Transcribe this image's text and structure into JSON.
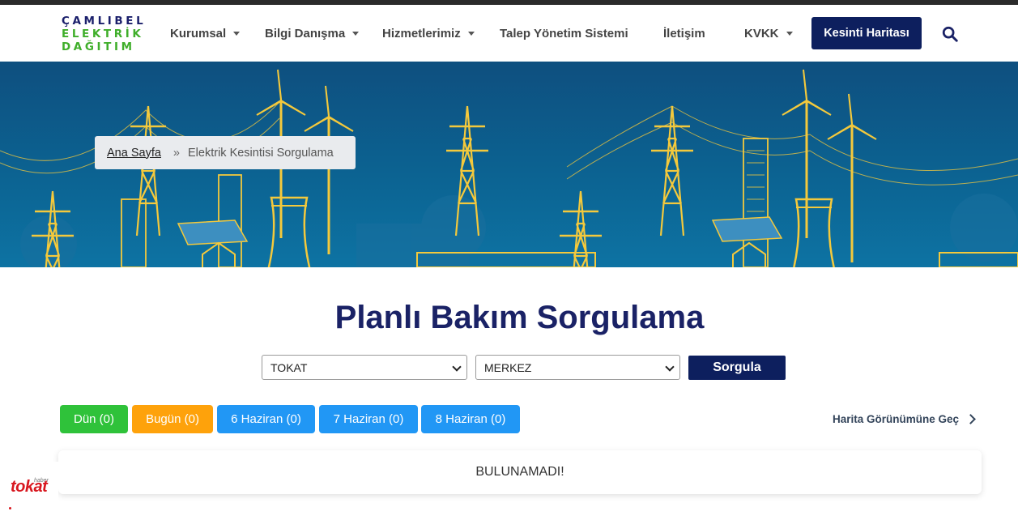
{
  "logo": {
    "line1": "ÇAMLIBEL",
    "line2": "ELEKTRİK",
    "line3": "DAĞITIM"
  },
  "nav": {
    "items": [
      {
        "label": "Kurumsal",
        "dropdown": true
      },
      {
        "label": "Bilgi Danışma",
        "dropdown": true
      },
      {
        "label": "Hizmetlerimiz",
        "dropdown": true
      },
      {
        "label": "Talep Yönetim Sistemi",
        "dropdown": false
      },
      {
        "label": "İletişim",
        "dropdown": false
      },
      {
        "label": "KVKK",
        "dropdown": true
      }
    ],
    "cta_label": "Kesinti Haritası",
    "search_icon": "search-icon"
  },
  "breadcrumb": {
    "home": "Ana Sayfa",
    "separator": "»",
    "current": "Elektrik Kesintisi Sorgulama"
  },
  "page": {
    "title": "Planlı Bakım Sorgulama"
  },
  "filters": {
    "city_value": "TOKAT",
    "district_value": "MERKEZ",
    "query_label": "Sorgula"
  },
  "days": [
    {
      "label": "Dün (0)",
      "color": "#2fc23a"
    },
    {
      "label": "Bugün (0)",
      "color": "#fea20b"
    },
    {
      "label": "6 Haziran (0)",
      "color": "#2197f5"
    },
    {
      "label": "7 Haziran (0)",
      "color": "#2197f5"
    },
    {
      "label": "8 Haziran (0)",
      "color": "#2197f5"
    }
  ],
  "map_view_link": "Harita Görünümüne Geç",
  "result": {
    "message": "BULUNAMADI!"
  },
  "badge": {
    "small": "haber",
    "big": "tokat"
  },
  "colors": {
    "brand_navy": "#0d1f5e",
    "title_navy": "#1a2266",
    "logo_green": "#3fae2a",
    "hero_blue": "#0c6190",
    "illustration_yellow": "#f4c93c"
  }
}
